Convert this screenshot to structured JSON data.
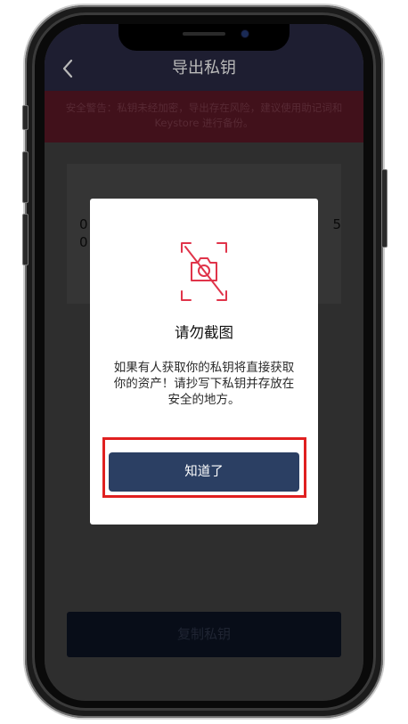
{
  "nav": {
    "title": "导出私钥",
    "back_icon": "chevron-left-icon"
  },
  "warning": {
    "text": "安全警告：私钥未经加密，导出存在风险，建议使用助记词和 Keystore 进行备份。"
  },
  "private_key": {
    "fragment_left": "00",
    "fragment_right": "5"
  },
  "copy_button": {
    "label": "复制私钥"
  },
  "modal": {
    "icon": "no-screenshot-icon",
    "title": "请勿截图",
    "description": "如果有人获取你的私钥将直接获取你的资产！请抄写下私钥并存放在安全的地方。",
    "ack_label": "知道了"
  },
  "colors": {
    "nav_bg": "#2a2a45",
    "warning_bg": "#5a1826",
    "ack_button": "#2b3f63",
    "highlight": "#e02020",
    "icon_red": "#e0344a"
  }
}
